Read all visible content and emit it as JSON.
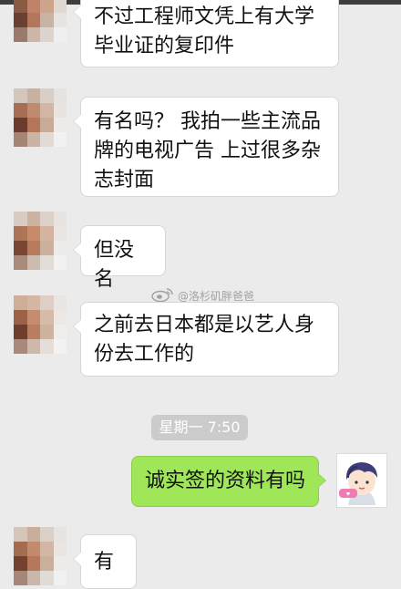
{
  "messages": [
    {
      "sender": "other",
      "text": "不过工程师文凭上有大学毕业证的复印件"
    },
    {
      "sender": "other",
      "text": "有名吗？ 我拍一些主流品牌的电视广告 上过很多杂志封面"
    },
    {
      "sender": "other",
      "text": "但没名"
    },
    {
      "sender": "other",
      "text": "之前去日本都是以艺人身份去工作的"
    },
    {
      "sender": "self",
      "text": "诚实签的资料有吗"
    },
    {
      "sender": "other",
      "text": "有"
    }
  ],
  "timestamp": "星期一 7:50",
  "watermark": "@洛杉矶胖爸爸",
  "colors": {
    "background": "#ebebeb",
    "bubble_other": "#ffffff",
    "bubble_self": "#9fe658",
    "time_pill": "#cbcbcb"
  },
  "icons": [
    "blurred-contact-avatar",
    "weibo-logo-icon",
    "cartoon-user-avatar"
  ]
}
